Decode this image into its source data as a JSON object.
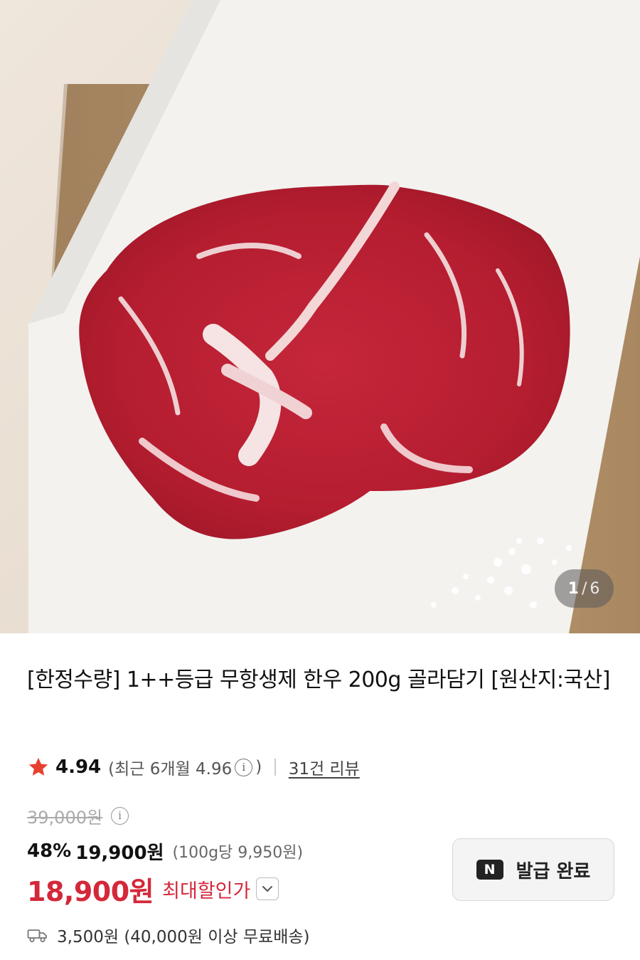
{
  "gallery": {
    "current": "1",
    "separator": "/",
    "total": "6"
  },
  "product": {
    "title": "[한정수량] 1++등급 무항생제 한우 200g 골라담기 [원산지:국산]"
  },
  "rating": {
    "score": "4.94",
    "recent_prefix": "(최근 6개월 4.96",
    "recent_suffix": ")",
    "info_glyph": "i",
    "reviews": "31건 리뷰"
  },
  "pricing": {
    "original": "39,000원",
    "discount": "48%",
    "sale": "19,900원",
    "unit": "(100g당 9,950원)",
    "max_discount_price": "18,900원",
    "max_discount_label": "최대할인가"
  },
  "coupon": {
    "badge": "N",
    "label": "발급 완료"
  },
  "shipping": {
    "text": "3,500원 (40,000원 이상 무료배송)"
  },
  "colors": {
    "accent_red": "#d4283a",
    "star": "#e8402f",
    "icons": [
      "star-icon",
      "info-icon",
      "chevron-down-icon",
      "truck-icon",
      "naver-n-icon"
    ]
  }
}
